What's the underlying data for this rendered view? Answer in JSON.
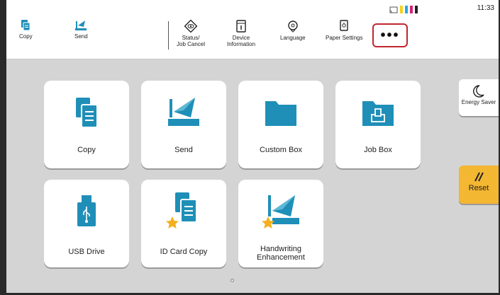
{
  "status_bar": {
    "time": "11:33"
  },
  "quick_bar": {
    "copy_label": "Copy",
    "send_label": "Send",
    "status_line1": "Status/",
    "status_line2": "Job Cancel",
    "device_line1": "Device",
    "device_line2": "Information",
    "language_label": "Language",
    "paper_settings_label": "Paper Settings",
    "more_label": "•••"
  },
  "home": {
    "tiles": [
      {
        "label": "Copy",
        "icon": "copy-icon"
      },
      {
        "label": "Send",
        "icon": "send-icon"
      },
      {
        "label": "Custom Box",
        "icon": "folder-icon"
      },
      {
        "label": "Job Box",
        "icon": "job-box-icon"
      },
      {
        "label": "USB Drive",
        "icon": "usb-icon"
      },
      {
        "label": "ID Card Copy",
        "icon": "id-card-copy-icon"
      },
      {
        "label_line1": "Handwriting",
        "label_line2": "Enhancement",
        "icon": "handwriting-icon"
      }
    ]
  },
  "side": {
    "energy_saver_label": "Energy Saver",
    "reset_label": "Reset"
  },
  "colors": {
    "accent": "#1f8fb8",
    "reset": "#f4b731",
    "star": "#f2b01e",
    "highlight": "#c0272d"
  }
}
